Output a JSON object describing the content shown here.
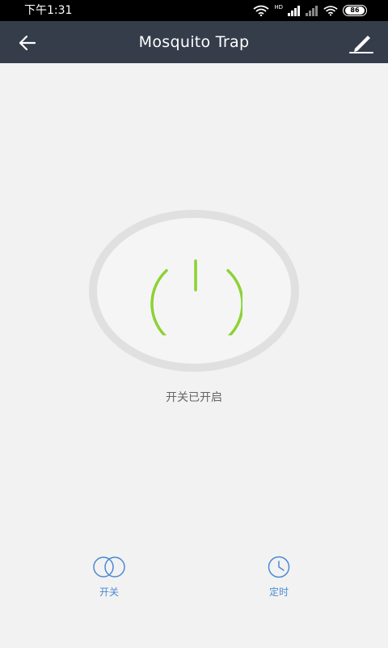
{
  "status_bar": {
    "time": "下午1:31",
    "battery": "86",
    "network_label": "HD"
  },
  "nav": {
    "title": "Mosquito Trap"
  },
  "main": {
    "power_status": "开关已开启",
    "power_color": "#8bd234"
  },
  "bottom": {
    "switch_label": "开关",
    "timer_label": "定时",
    "accent_color": "#4a8ad3"
  },
  "icons": {
    "back": "back-arrow-icon",
    "edit": "pencil-icon",
    "power": "power-icon",
    "switch": "toggle-circles-icon",
    "timer": "clock-icon"
  }
}
